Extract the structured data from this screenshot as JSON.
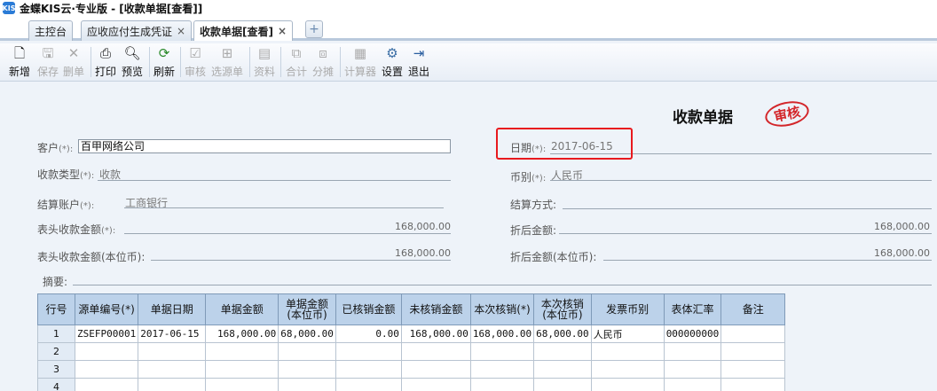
{
  "app": {
    "logo": "KIS",
    "title": "金蝶KIS云·专业版 - [收款单据[查看]]"
  },
  "tabs": [
    {
      "label": "主控台"
    },
    {
      "label": "应收应付生成凭证"
    },
    {
      "label": "收款单据[查看]"
    }
  ],
  "tab_close": "×",
  "tab_add": "+",
  "toolbar": {
    "new": "新增",
    "save": "保存",
    "delete": "删单",
    "print": "打印",
    "preview": "预览",
    "refresh": "刷新",
    "audit": "审核",
    "source": "选源单",
    "info": "资料",
    "combine": "合计",
    "split": "分摊",
    "calculator": "计算器",
    "settings": "设置",
    "exit": "退出"
  },
  "form": {
    "doc_title": "收款单据",
    "seal": "审核",
    "req_mark": "(*):",
    "customer_label": "客户",
    "customer_value": "百甲网络公司",
    "date_label": "日期",
    "date_value": "2017-06-15",
    "type_label": "收款类型",
    "type_value": "收款",
    "currency_label": "币别",
    "currency_value": "人民币",
    "account_label": "结算账户",
    "account_value": "工商银行",
    "method_label": "结算方式:",
    "head_amount_label": "表头收款金额",
    "head_amount_value": "168,000.00",
    "converted_label": "折后金额:",
    "converted_value": "168,000.00",
    "head_amount_base_label": "表头收款金额(本位币):",
    "head_amount_base_value": "168,000.00",
    "converted_base_label": "折后金额(本位币):",
    "converted_base_value": "168,000.00",
    "summary_label": "摘要:"
  },
  "grid": {
    "headers": [
      "行号",
      "源单编号(*)",
      "单据日期",
      "单据金额",
      "单据金额(本位币)",
      "已核销金额",
      "未核销金额",
      "本次核销(*)",
      "本次核销(本位币)",
      "发票币别",
      "表体汇率",
      "备注"
    ],
    "rows": [
      [
        "1",
        "ZSEFP00001",
        "2017-06-15",
        "168,000.00",
        "68,000.00",
        "0.00",
        "168,000.00",
        "168,000.00",
        "68,000.00",
        "人民币",
        "000000000",
        ""
      ],
      [
        "2",
        "",
        "",
        "",
        "",
        "",
        "",
        "",
        "",
        "",
        "",
        ""
      ],
      [
        "3",
        "",
        "",
        "",
        "",
        "",
        "",
        "",
        "",
        "",
        "",
        ""
      ],
      [
        "4",
        "",
        "",
        "",
        "",
        "",
        "",
        "",
        "",
        "",
        "",
        ""
      ]
    ]
  }
}
